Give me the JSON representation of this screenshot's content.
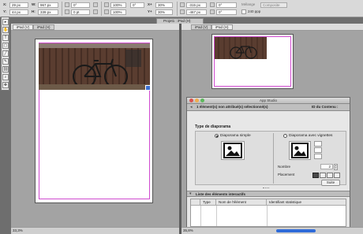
{
  "control_bar": {
    "x_label": "X:",
    "x_value": "29 px",
    "y_label": "Y:",
    "y_value": "44 px",
    "w_label": "W:",
    "w_value": "967 px",
    "h_label": "H:",
    "h_value": "339 px",
    "stroke_value": "0 pt",
    "pct1": "100%",
    "pct2": "100%",
    "angle1": "0°",
    "angle2": "0°",
    "x2_label": "X+",
    "x2_value": "30%",
    "y2_label": "Y+",
    "y2_value": "30%",
    "x3_value": "-315 px",
    "y3_value": "-467 px",
    "rot_value": "0°",
    "mode_label": "Mélange",
    "mode_value": "Composite",
    "ppp_value": "240 ppp"
  },
  "document": {
    "tab_title": "Projet1 : iPad (H)"
  },
  "left_pane": {
    "tab_active": "iPad (V)",
    "tab_inactive": "iPad (H)",
    "zoom": "33,3%"
  },
  "right_pane": {
    "tab_inactive": "iPad (V)",
    "tab_active": "iPad (H)",
    "zoom": "35,8%"
  },
  "app_studio": {
    "title": "App Studio",
    "selection_text": "1 élément(s) non attribué(s) sélectionné(s)",
    "id_label": "ID du Contenu :",
    "section_title": "Type de diaporama",
    "option_simple": "Diaporama simple",
    "option_thumbs": "Diaporama avec vignettes",
    "nombre_label": "Nombre",
    "nombre_value": "2",
    "placement_label": "Placement",
    "suite_button": "Suite",
    "list_title": "Liste des éléments interactifs",
    "col_type": "Type",
    "col_name": "Nom de l'élément",
    "col_id": "Identifiant statistique"
  },
  "colors": {
    "accent": "#2f6bd8",
    "guide": "#d04ad0",
    "panel": "#e7e7e7"
  }
}
